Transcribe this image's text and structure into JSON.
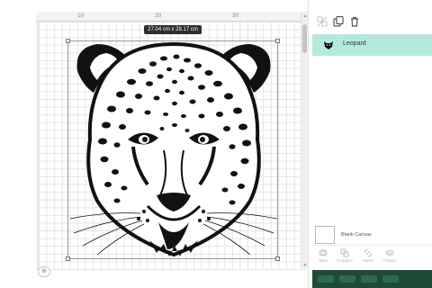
{
  "canvas": {
    "ruler_marks": [
      "10",
      "20",
      "30"
    ],
    "dimension_label": "27.04  cm x 28.17  cm",
    "artwork_name": "leopard-head-silhouette"
  },
  "toolbar": {
    "icons": [
      "ungroup-icon",
      "duplicate-icon",
      "delete-icon"
    ]
  },
  "layers": {
    "items": [
      {
        "label": "Leopard",
        "icon": "leopard-thumbnail"
      }
    ]
  },
  "bottom_panel": {
    "blank_canvas_label": "Blank Canvas",
    "actions": [
      "Slice",
      "Combine",
      "Attach",
      "Flatten"
    ]
  },
  "colors": {
    "accent": "#b4eadc",
    "tooltip_bg": "#2e2e2e",
    "bottom_strip": "#1f4a35"
  }
}
